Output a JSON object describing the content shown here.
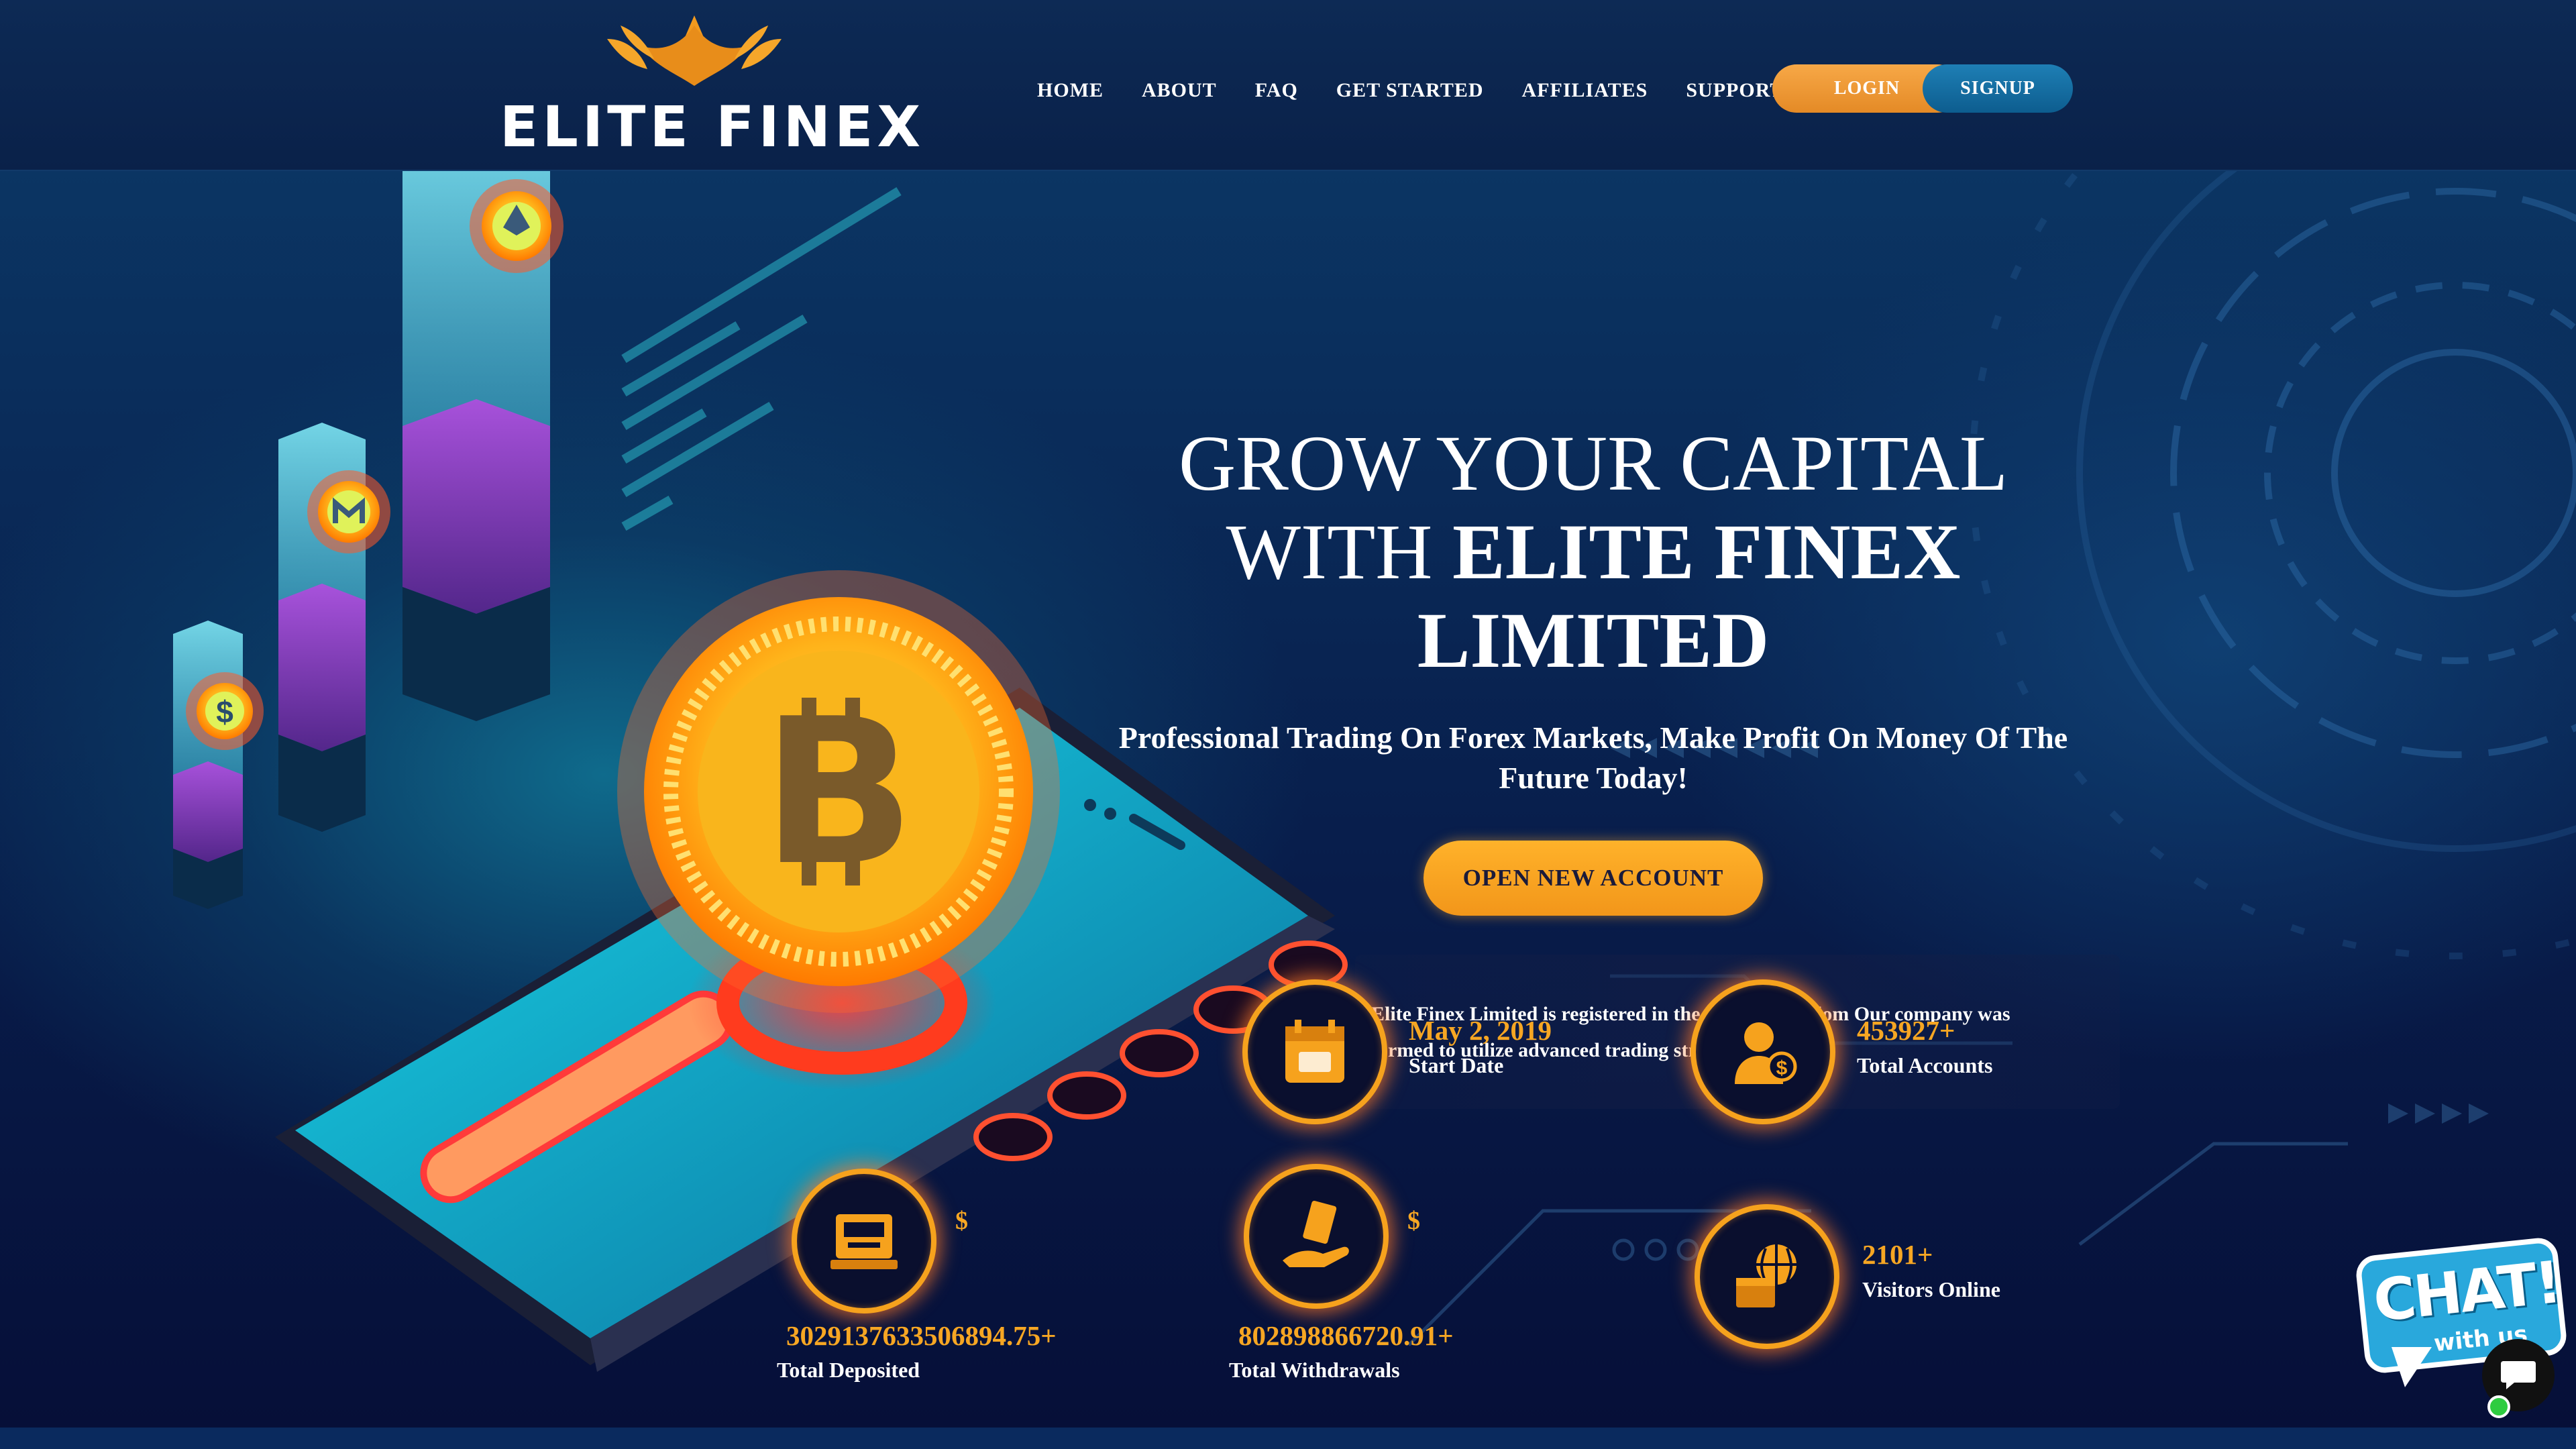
{
  "brand": {
    "name": "ELITE FINEX"
  },
  "nav": {
    "items": [
      "HOME",
      "ABOUT",
      "FAQ",
      "GET STARTED",
      "AFFILIATES",
      "SUPPORT"
    ],
    "login": "LOGIN",
    "signup": "SIGNUP"
  },
  "hero": {
    "headline_line1": "GROW YOUR CAPITAL",
    "headline_with": "WITH",
    "headline_bold1": "ELITE FINEX",
    "headline_bold2": "LIMITED",
    "subtitle": "Professional Trading On Forex Markets, Make Profit On Money Of The Future Today!",
    "cta": "OPEN NEW ACCOUNT",
    "about": "Elite Finex Limited is registered in the United Kingdom Our company was formed to utilize advanced trading strategies."
  },
  "stats": {
    "start_date": {
      "value": "May 2, 2019",
      "label": "Start Date"
    },
    "total_accounts": {
      "value": "453927+",
      "label": "Total Accounts"
    },
    "total_deposited": {
      "currency": "$",
      "value": "3029137633506894.75+",
      "label": "Total Deposited"
    },
    "total_withdrawals": {
      "currency": "$",
      "value": "802898866720.91+",
      "label": "Total Withdrawals"
    },
    "visitors_online": {
      "value": "2101+",
      "label": "Visitors Online"
    }
  },
  "chat": {
    "title": "CHAT!",
    "subtitle": "with us"
  },
  "colors": {
    "accent": "#f6a21d",
    "signup": "#0d5d8f",
    "header": "#0b2450",
    "cyan": "#20c8e0"
  },
  "icons": [
    "logo-emblem-icon",
    "bitcoin-coin-icon",
    "ethereum-icon",
    "monero-icon",
    "dollar-icon",
    "calendar-icon",
    "user-dollar-icon",
    "deposit-machine-icon",
    "withdraw-hand-icon",
    "globe-box-icon",
    "chat-bubble-icon"
  ]
}
